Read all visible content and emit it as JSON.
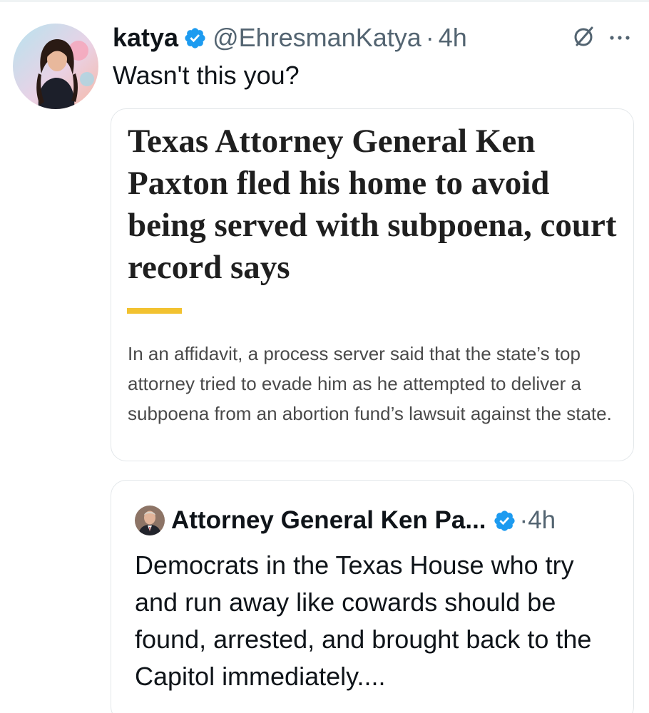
{
  "tweet": {
    "author_name": "katya",
    "author_handle": "@EhresmanKatya",
    "separator": "·",
    "time": "4h",
    "text": "Wasn't this you?",
    "colors": {
      "verified_badge": "#1d9bf0",
      "meta_gray": "#536471",
      "text": "#0f1419"
    },
    "icons": [
      "verified-badge-icon",
      "grok-slash-icon",
      "more-options-icon"
    ]
  },
  "article": {
    "headline": "Texas Attorney General Ken Paxton fled his home to avoid being served with subpoena, court record says",
    "summary": "In an affidavit, a process server said that the state’s top attorney tried to evade him as he attempted to deliver a subpoena from an abortion fund’s lawsuit against the state.",
    "accent_color": "#f2c230"
  },
  "quoted_tweet": {
    "author_name": "Attorney General Ken Pa...",
    "separator": "·",
    "time": "4h",
    "text": "Democrats in the Texas House who try and run away like cowards should be found, arrested, and brought back to the Capitol immediately...."
  }
}
